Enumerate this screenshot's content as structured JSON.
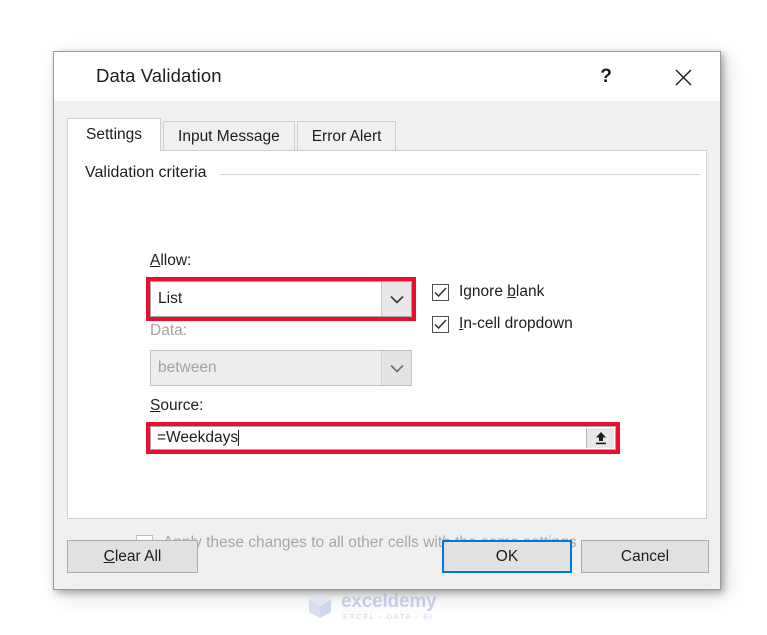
{
  "dialog": {
    "title": "Data Validation",
    "help_button": "?",
    "close_button_icon": "close-icon"
  },
  "tabs": [
    {
      "label": "Settings",
      "active": true
    },
    {
      "label": "Input Message",
      "active": false
    },
    {
      "label": "Error Alert",
      "active": false
    }
  ],
  "settings": {
    "group_title": "Validation criteria",
    "allow": {
      "label_pre": "",
      "label_acc": "A",
      "label_post": "llow:",
      "value": "List",
      "highlighted": true
    },
    "data": {
      "label": "Data:",
      "value": "between",
      "disabled": true
    },
    "source": {
      "label_acc": "S",
      "label_post": "ource:",
      "value": "=Weekdays",
      "picker_icon": "collapse-dialog-icon",
      "highlighted": true
    },
    "ignore_blank": {
      "label_pre": "Ignore ",
      "label_acc": "b",
      "label_post": "lank",
      "checked": true
    },
    "in_cell_dropdown": {
      "label_acc": "I",
      "label_post": "n-cell dropdown",
      "checked": true
    },
    "apply_changes": {
      "label": "Apply these changes to all other cells with the same settings",
      "checked": false,
      "disabled": true
    }
  },
  "buttons": {
    "clear_all_acc": "C",
    "clear_all_post": "lear All",
    "ok": "OK",
    "cancel": "Cancel"
  },
  "watermark": {
    "word": "exceldemy",
    "tagline": "EXCEL - DATA - BI"
  },
  "colors": {
    "highlight_red": "#e8112d",
    "focus_blue": "#0078d7",
    "dialog_bg": "#f0f0f0",
    "panel_bg": "#ffffff"
  }
}
